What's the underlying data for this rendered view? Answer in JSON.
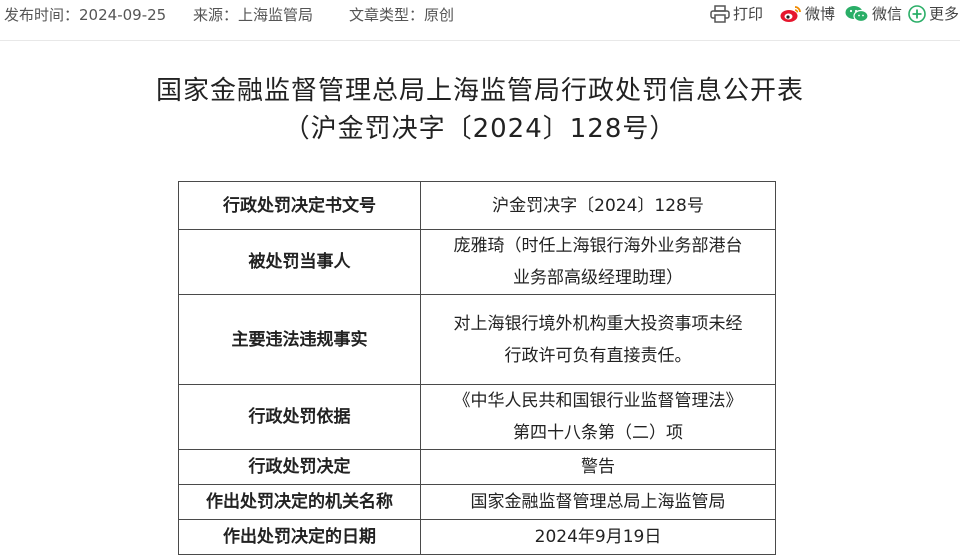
{
  "meta": {
    "date_label": "发布时间：",
    "date": "2024-09-25",
    "source_label": "来源：",
    "source": "上海监管局",
    "type_label": "文章类型：",
    "type": "原创"
  },
  "share": {
    "print": "打印",
    "weibo": "微博",
    "wechat": "微信",
    "more": "更多"
  },
  "title": {
    "line1": "国家金融监督管理总局上海监管局行政处罚信息公开表",
    "line2": "（沪金罚决字〔2024〕128号）"
  },
  "table": {
    "rows": [
      {
        "label": "行政处罚决定书文号",
        "value": "沪金罚决字〔2024〕128号"
      },
      {
        "label": "被处罚当事人",
        "value_line1": "庞雅琦（时任上海银行海外业务部港台",
        "value_line2": "业务部高级经理助理）"
      },
      {
        "label": "主要违法违规事实",
        "value_line1": "对上海银行境外机构重大投资事项未经",
        "value_line2": "行政许可负有直接责任。"
      },
      {
        "label": "行政处罚依据",
        "value_line1": "《中华人民共和国银行业监督管理法》",
        "value_line2": "第四十八条第（二）项"
      },
      {
        "label": "行政处罚决定",
        "value": "警告"
      },
      {
        "label": "作出处罚决定的机关名称",
        "value": "国家金融监督管理总局上海监管局"
      },
      {
        "label": "作出处罚决定的日期",
        "value": "2024年9月19日"
      }
    ]
  },
  "colors": {
    "weibo": "#e6162d",
    "wechat": "#2aae67",
    "more": "#2aae67",
    "border": "#4a4a4a"
  },
  "icons": [
    "printer-icon",
    "weibo-icon",
    "wechat-icon",
    "more-plus-icon"
  ]
}
